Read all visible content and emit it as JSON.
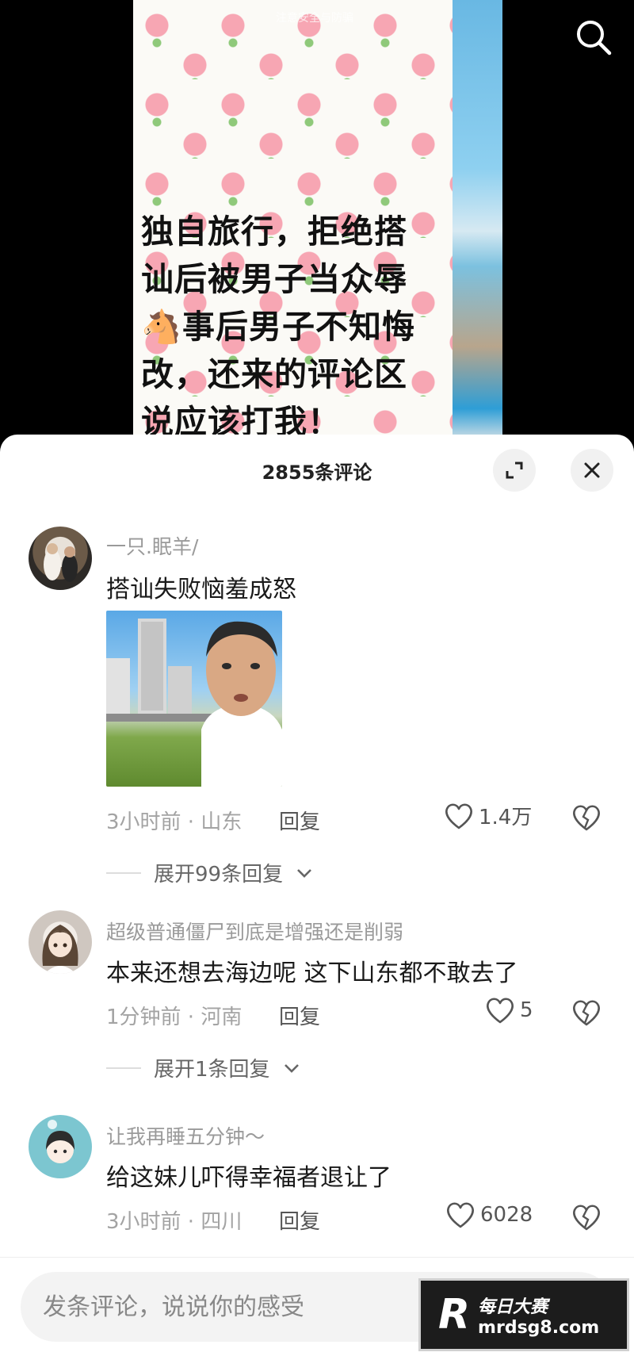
{
  "video": {
    "watermark": "注意安全与防骗",
    "caption": "独自旅行，拒绝搭\n讪后被男子当众辱\n🐴事后男子不知悔\n改，还来的评论区\n说应该打我！"
  },
  "comments_sheet": {
    "title": "2855条评论",
    "comments": [
      {
        "user": "一只.眠羊/",
        "text": "搭讪失败恼羞成怒",
        "meta": "3小时前 · 山东",
        "reply_label": "回复",
        "likes": "1.4万",
        "expand_label": "展开99条回复"
      },
      {
        "user": "超级普通僵尸到底是增强还是削弱",
        "text": "本来还想去海边呢 这下山东都不敢去了",
        "meta": "1分钟前 · 河南",
        "reply_label": "回复",
        "likes": "5",
        "expand_label": "展开1条回复"
      },
      {
        "user": "让我再睡五分钟～",
        "text": "给这妹儿吓得幸福者退让了",
        "meta": "3小时前 · 四川",
        "reply_label": "回复",
        "likes": "6028"
      }
    ]
  },
  "input": {
    "placeholder": "发条评论，说说你的感受"
  },
  "badge": {
    "logo": "R",
    "line1": "每日大赛",
    "line2": "mrdsg8.com"
  },
  "icons": {
    "search": "search-icon",
    "expand": "expand-icon",
    "close": "close-icon",
    "like": "heart-icon",
    "dislike": "broken-heart-icon",
    "chevron": "chevron-down-icon"
  }
}
